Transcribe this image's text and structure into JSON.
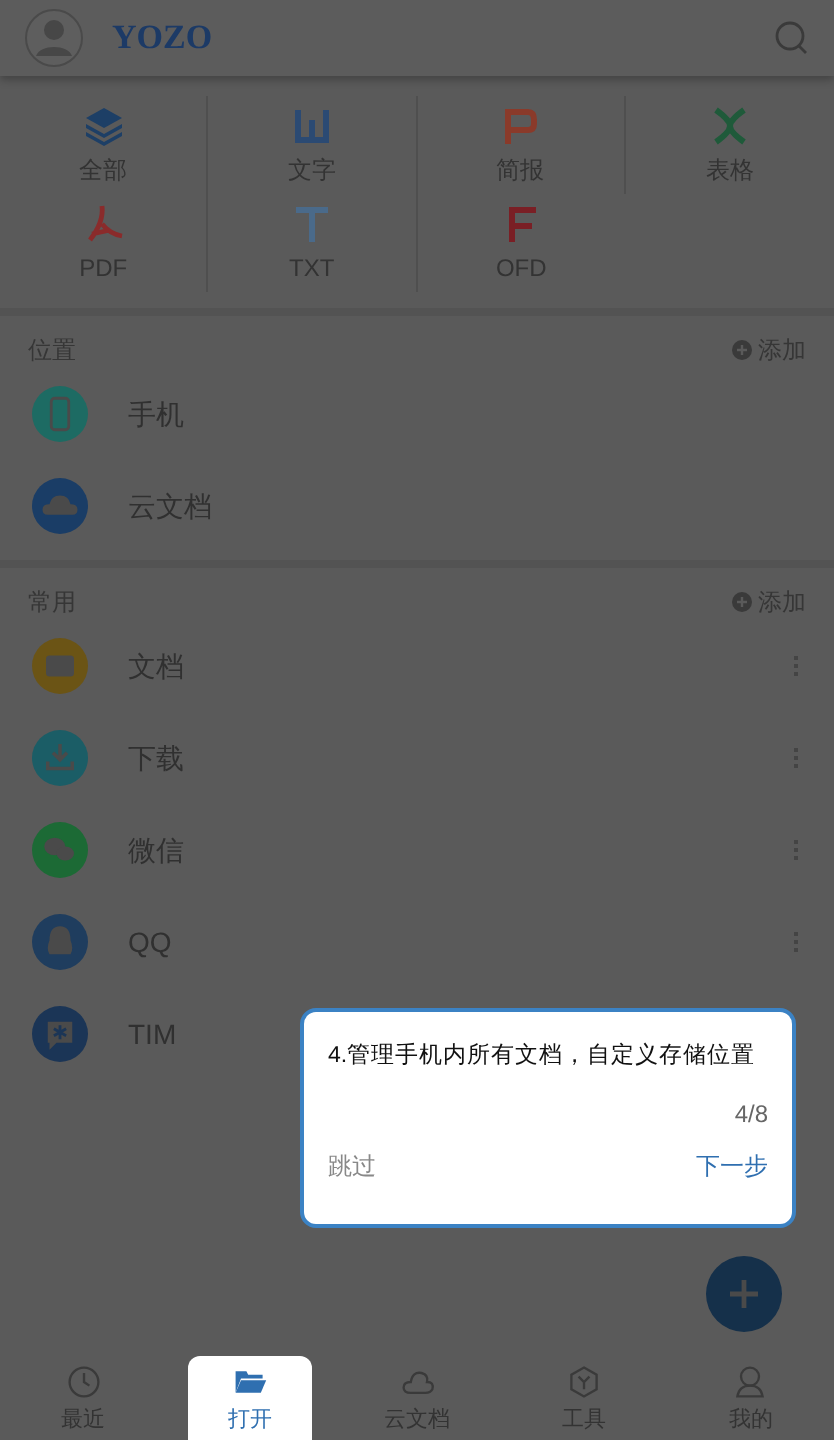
{
  "header": {
    "logo": "YOZO"
  },
  "file_types": [
    {
      "label": "全部",
      "kind": "all"
    },
    {
      "label": "文字",
      "kind": "word"
    },
    {
      "label": "简报",
      "kind": "slides"
    },
    {
      "label": "表格",
      "kind": "sheet"
    },
    {
      "label": "PDF",
      "kind": "pdf"
    },
    {
      "label": "TXT",
      "kind": "txt"
    },
    {
      "label": "OFD",
      "kind": "ofd"
    }
  ],
  "sections": [
    {
      "title": "位置",
      "add_label": "添加",
      "items": [
        {
          "label": "手机",
          "kind": "phone",
          "menu": false
        },
        {
          "label": "云文档",
          "kind": "cloud",
          "menu": false
        }
      ]
    },
    {
      "title": "常用",
      "add_label": "添加",
      "items": [
        {
          "label": "文档",
          "kind": "folder",
          "menu": true
        },
        {
          "label": "下载",
          "kind": "download",
          "menu": true
        },
        {
          "label": "微信",
          "kind": "wechat",
          "menu": true
        },
        {
          "label": "QQ",
          "kind": "qq",
          "menu": true
        },
        {
          "label": "TIM",
          "kind": "tim",
          "menu": false
        }
      ]
    }
  ],
  "guide": {
    "text": "4.管理手机内所有文档，自定义存储位置",
    "progress": "4/8",
    "skip": "跳过",
    "next": "下一步"
  },
  "bottom_nav": [
    {
      "label": "最近",
      "kind": "clock",
      "selected": false
    },
    {
      "label": "打开",
      "kind": "open",
      "selected": true
    },
    {
      "label": "云文档",
      "kind": "cloud",
      "selected": false
    },
    {
      "label": "工具",
      "kind": "tools",
      "selected": false
    },
    {
      "label": "我的",
      "kind": "me",
      "selected": false
    }
  ]
}
